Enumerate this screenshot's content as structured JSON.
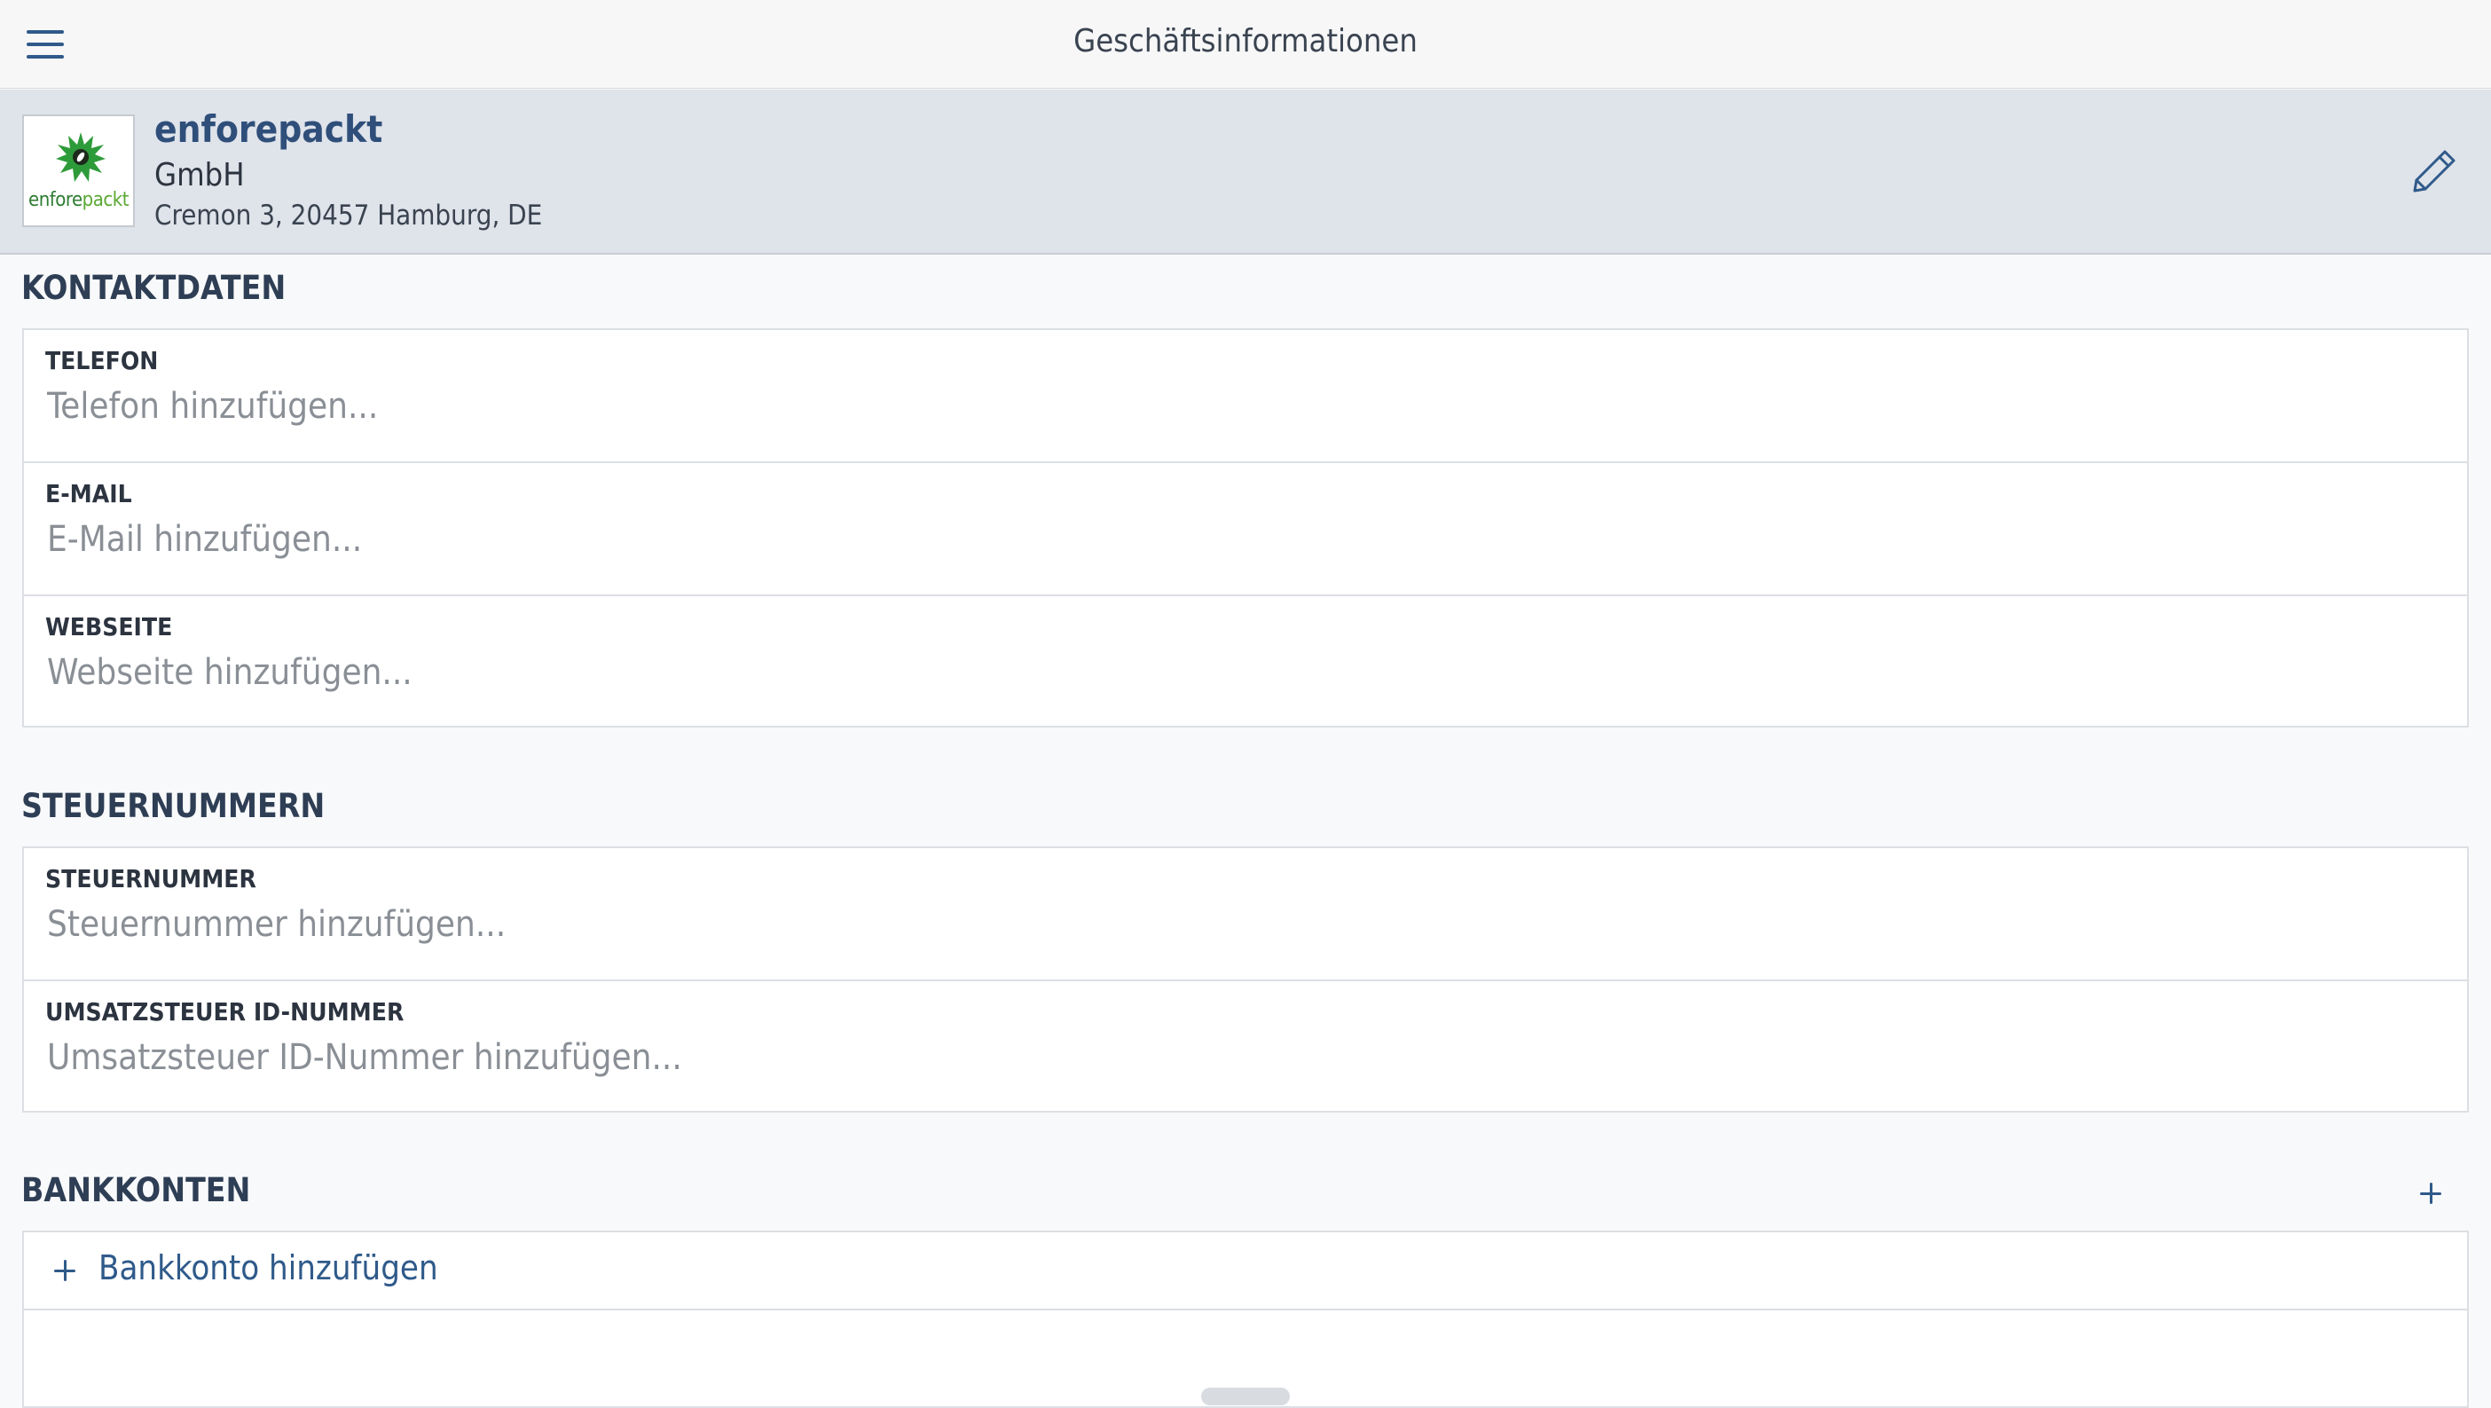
{
  "header": {
    "title": "Geschäftsinformationen"
  },
  "company": {
    "name": "enforepackt",
    "legal_form": "GmbH",
    "address": "Cremon 3, 20457 Hamburg, DE",
    "logo_text_dark": "enfore",
    "logo_text_light": "packt"
  },
  "contact": {
    "section_title": "KONTAKTDATEN",
    "fields": [
      {
        "label": "TELEFON",
        "value": "",
        "placeholder": "Telefon hinzufügen..."
      },
      {
        "label": "E-MAIL",
        "value": "",
        "placeholder": "E-Mail hinzufügen..."
      },
      {
        "label": "WEBSEITE",
        "value": "",
        "placeholder": "Webseite hinzufügen..."
      }
    ]
  },
  "tax": {
    "section_title": "STEUERNUMMERN",
    "fields": [
      {
        "label": "STEUERNUMMER",
        "value": "",
        "placeholder": "Steuernummer hinzufügen..."
      },
      {
        "label": "UMSATZSTEUER ID-NUMMER",
        "value": "",
        "placeholder": "Umsatzsteuer ID-Nummer hinzufügen..."
      }
    ]
  },
  "bank": {
    "section_title": "BANKKONTEN",
    "add_label": "Bankkonto hinzufügen"
  },
  "icons": {
    "menu": "hamburger-menu-icon",
    "edit": "pencil-icon",
    "add": "plus-icon",
    "logo": "green-starburst-logo"
  },
  "colors": {
    "accent": "#2f5a8a",
    "header_band": "#dfe3ea",
    "logo_green": "#2e7d32"
  }
}
